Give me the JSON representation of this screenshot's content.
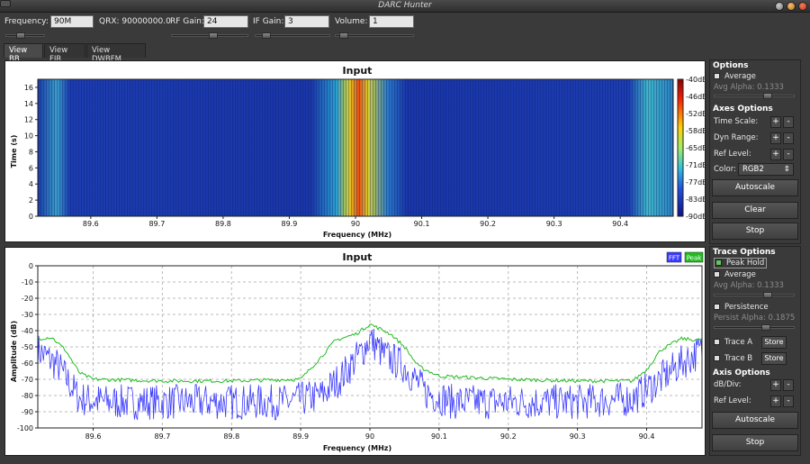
{
  "window": {
    "title": "DARC Hunter"
  },
  "controls": {
    "frequency_label": "Frequency:",
    "frequency_value": "90M",
    "qrx": "QRX: 90000000.0",
    "rf_gain_label": "RF Gain:",
    "rf_gain_value": "24",
    "rf_gain_pos": 0.55,
    "if_gain_label": "IF Gain:",
    "if_gain_value": "3",
    "if_gain_pos": 0.1,
    "volume_label": "Volume:",
    "volume_value": "1",
    "volume_pos": 0.05,
    "freq_slider_pos": 0.35
  },
  "tabs": [
    "View BB",
    "View FIR",
    "View DWBFM"
  ],
  "waterfall": {
    "title": "Input",
    "xlabel": "Frequency (MHz)",
    "ylabel": "Time (s)",
    "xticks": [
      "89.6",
      "89.7",
      "89.8",
      "89.9",
      "90",
      "90.1",
      "90.2",
      "90.3",
      "90.4"
    ],
    "yticks": [
      "0",
      "2",
      "4",
      "6",
      "8",
      "10",
      "12",
      "14",
      "16"
    ],
    "colorbar": [
      "-40dB",
      "-46dB",
      "-52dB",
      "-58dB",
      "-65dB",
      "-71dB",
      "-77dB",
      "-83dB",
      "-90dB"
    ]
  },
  "chart_data": {
    "type": "line",
    "title": "Input",
    "xlabel": "Frequency (MHz)",
    "ylabel": "Amplitude (dB)",
    "xlim": [
      89.52,
      90.48
    ],
    "ylim": [
      -100,
      0
    ],
    "xticks": [
      "89.6",
      "89.7",
      "89.8",
      "89.9",
      "90",
      "90.1",
      "90.2",
      "90.3",
      "90.4"
    ],
    "yticks": [
      "0",
      "-10",
      "-20",
      "-30",
      "-40",
      "-50",
      "-60",
      "-70",
      "-80",
      "-90",
      "-100"
    ],
    "grid": true,
    "legend": "top-right",
    "series": [
      {
        "name": "FFT",
        "color": "#3b3bff",
        "x": [
          89.52,
          89.55,
          89.58,
          89.62,
          89.7,
          89.8,
          89.88,
          89.93,
          89.96,
          89.99,
          90.0,
          90.02,
          90.05,
          90.08,
          90.12,
          90.2,
          90.3,
          90.38,
          90.42,
          90.45,
          90.48
        ],
        "y": [
          -52,
          -62,
          -82,
          -84,
          -84,
          -84,
          -84,
          -80,
          -68,
          -52,
          -45,
          -55,
          -62,
          -78,
          -84,
          -84,
          -84,
          -82,
          -70,
          -60,
          -52
        ]
      },
      {
        "name": "Peak",
        "color": "#22bb22",
        "x": [
          89.52,
          89.54,
          89.56,
          89.58,
          89.6,
          89.7,
          89.8,
          89.9,
          89.93,
          89.95,
          89.98,
          90.0,
          90.03,
          90.05,
          90.07,
          90.1,
          90.2,
          90.3,
          90.38,
          90.4,
          90.42,
          90.45,
          90.48
        ],
        "y": [
          -45,
          -44,
          -52,
          -66,
          -70,
          -71,
          -71,
          -70,
          -56,
          -46,
          -42,
          -36,
          -42,
          -50,
          -62,
          -68,
          -70,
          -71,
          -71,
          -64,
          -52,
          -45,
          -46
        ]
      }
    ]
  },
  "side_top": {
    "options_header": "Options",
    "average_label": "Average",
    "avg_alpha_label": "Avg Alpha: 0.1333",
    "axes_header": "Axes Options",
    "time_scale_label": "Time Scale:",
    "dyn_range_label": "Dyn Range:",
    "ref_level_label": "Ref Level:",
    "color_label": "Color:",
    "color_value": "RGB2",
    "autoscale": "Autoscale",
    "clear": "Clear",
    "stop": "Stop"
  },
  "side_bottom": {
    "trace_header": "Trace Options",
    "peak_hold_label": "Peak Hold",
    "average_label": "Average",
    "avg_alpha_label": "Avg Alpha: 0.1333",
    "persistence_label": "Persistence",
    "persist_alpha_label": "Persist Alpha: 0.1875",
    "trace_a_label": "Trace A",
    "trace_b_label": "Trace B",
    "store_label": "Store",
    "axis_header": "Axis Options",
    "db_div_label": "dB/Div:",
    "ref_level_label": "Ref Level:",
    "autoscale": "Autoscale",
    "stop": "Stop"
  },
  "plus": "+",
  "minus": "-",
  "colors": {
    "fft": "#3b3bff",
    "peak": "#22bb22",
    "panel_bg": "#3a3a3a"
  }
}
